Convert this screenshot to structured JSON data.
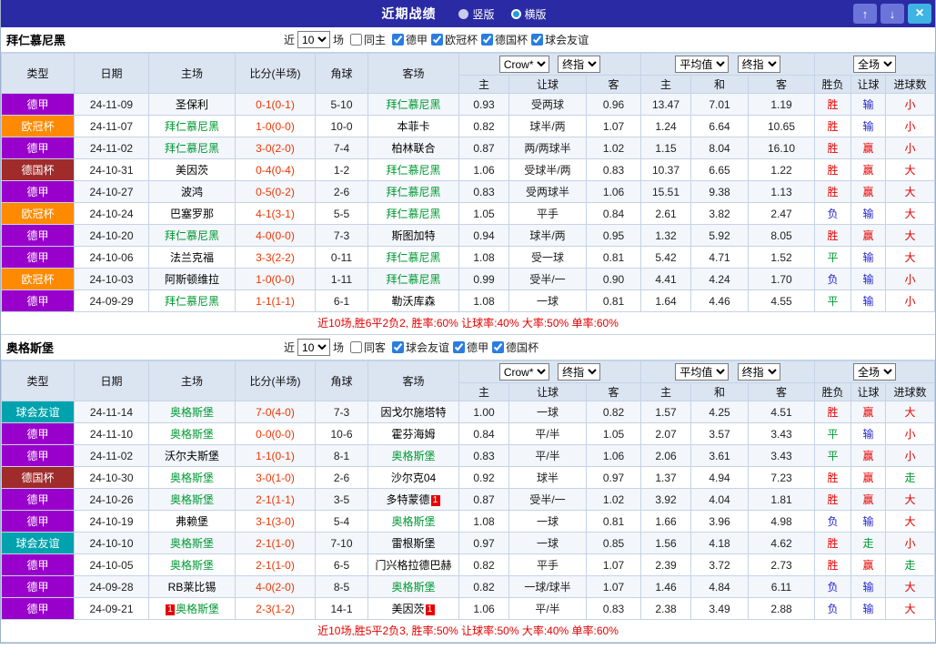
{
  "titlebar": {
    "title": "近期战绩",
    "options": [
      {
        "label": "竖版",
        "selected": false
      },
      {
        "label": "横版",
        "selected": true
      }
    ],
    "buttons": {
      "up": "↑",
      "down": "↓",
      "close": "×"
    }
  },
  "colors": {
    "titlebar_bg": "#2a2aa4",
    "header_bg": "#dbe5f2",
    "type": {
      "德甲": "#9900cc",
      "欧冠杯": "#ff8a00",
      "德国杯": "#a02b2b",
      "球会友谊": "#00a3ad"
    },
    "result": {
      "胜": "#e60000",
      "平": "#009933",
      "负": "#2525d0",
      "赢": "#e60000",
      "走": "#009933",
      "输": "#2525d0",
      "大": "#e60000",
      "小": "#e60000"
    },
    "self_team": "#009933",
    "score": "#f03500",
    "summary": "#e60000"
  },
  "table_header": {
    "type": "类型",
    "date": "日期",
    "home": "主场",
    "score": "比分(半场)",
    "corner": "角球",
    "away": "客场",
    "ah_home": "主",
    "ah_line": "让球",
    "ah_away": "客",
    "eu_home": "主",
    "eu_draw": "和",
    "eu_away": "客",
    "result": "胜负",
    "handicap": "让球",
    "goals": "进球数"
  },
  "sections": [
    {
      "team": "拜仁慕尼黑",
      "filter": {
        "near": "近",
        "count": "10",
        "games": "场",
        "same_label": "同主",
        "same_checked": false,
        "leagues": [
          {
            "label": "德甲",
            "checked": true
          },
          {
            "label": "欧冠杯",
            "checked": true
          },
          {
            "label": "德国杯",
            "checked": true
          },
          {
            "label": "球会友谊",
            "checked": true
          }
        ]
      },
      "dropdowns": {
        "source": "Crow*",
        "source_time": "终指",
        "avg": "平均值",
        "avg_time": "终指",
        "scope": "全场"
      },
      "rows": [
        {
          "type": "德甲",
          "date": "24-11-09",
          "home": "圣保利",
          "home_self": false,
          "score": "0-1(0-1)",
          "corner": "5-10",
          "away": "拜仁慕尼黑",
          "away_self": true,
          "ah": [
            "0.93",
            "受两球",
            "0.96"
          ],
          "eu": [
            "13.47",
            "7.01",
            "1.19"
          ],
          "res": [
            "胜",
            "输",
            "小"
          ]
        },
        {
          "type": "欧冠杯",
          "date": "24-11-07",
          "home": "拜仁慕尼黑",
          "home_self": true,
          "score": "1-0(0-0)",
          "corner": "10-0",
          "away": "本菲卡",
          "away_self": false,
          "ah": [
            "0.82",
            "球半/两",
            "1.07"
          ],
          "eu": [
            "1.24",
            "6.64",
            "10.65"
          ],
          "res": [
            "胜",
            "输",
            "小"
          ]
        },
        {
          "type": "德甲",
          "date": "24-11-02",
          "home": "拜仁慕尼黑",
          "home_self": true,
          "score": "3-0(2-0)",
          "corner": "7-4",
          "away": "柏林联合",
          "away_self": false,
          "ah": [
            "0.87",
            "两/两球半",
            "1.02"
          ],
          "eu": [
            "1.15",
            "8.04",
            "16.10"
          ],
          "res": [
            "胜",
            "赢",
            "小"
          ]
        },
        {
          "type": "德国杯",
          "date": "24-10-31",
          "home": "美因茨",
          "home_self": false,
          "score": "0-4(0-4)",
          "corner": "1-2",
          "away": "拜仁慕尼黑",
          "away_self": true,
          "ah": [
            "1.06",
            "受球半/两",
            "0.83"
          ],
          "eu": [
            "10.37",
            "6.65",
            "1.22"
          ],
          "res": [
            "胜",
            "赢",
            "大"
          ]
        },
        {
          "type": "德甲",
          "date": "24-10-27",
          "home": "波鸿",
          "home_self": false,
          "score": "0-5(0-2)",
          "corner": "2-6",
          "away": "拜仁慕尼黑",
          "away_self": true,
          "ah": [
            "0.83",
            "受两球半",
            "1.06"
          ],
          "eu": [
            "15.51",
            "9.38",
            "1.13"
          ],
          "res": [
            "胜",
            "赢",
            "大"
          ]
        },
        {
          "type": "欧冠杯",
          "date": "24-10-24",
          "home": "巴塞罗那",
          "home_self": false,
          "score": "4-1(3-1)",
          "corner": "5-5",
          "away": "拜仁慕尼黑",
          "away_self": true,
          "ah": [
            "1.05",
            "平手",
            "0.84"
          ],
          "eu": [
            "2.61",
            "3.82",
            "2.47"
          ],
          "res": [
            "负",
            "输",
            "大"
          ]
        },
        {
          "type": "德甲",
          "date": "24-10-20",
          "home": "拜仁慕尼黑",
          "home_self": true,
          "score": "4-0(0-0)",
          "corner": "7-3",
          "away": "斯图加特",
          "away_self": false,
          "ah": [
            "0.94",
            "球半/两",
            "0.95"
          ],
          "eu": [
            "1.32",
            "5.92",
            "8.05"
          ],
          "res": [
            "胜",
            "赢",
            "大"
          ]
        },
        {
          "type": "德甲",
          "date": "24-10-06",
          "home": "法兰克福",
          "home_self": false,
          "score": "3-3(2-2)",
          "corner": "0-11",
          "away": "拜仁慕尼黑",
          "away_self": true,
          "ah": [
            "1.08",
            "受一球",
            "0.81"
          ],
          "eu": [
            "5.42",
            "4.71",
            "1.52"
          ],
          "res": [
            "平",
            "输",
            "大"
          ]
        },
        {
          "type": "欧冠杯",
          "date": "24-10-03",
          "home": "阿斯顿维拉",
          "home_self": false,
          "score": "1-0(0-0)",
          "corner": "1-11",
          "away": "拜仁慕尼黑",
          "away_self": true,
          "ah": [
            "0.99",
            "受半/一",
            "0.90"
          ],
          "eu": [
            "4.41",
            "4.24",
            "1.70"
          ],
          "res": [
            "负",
            "输",
            "小"
          ]
        },
        {
          "type": "德甲",
          "date": "24-09-29",
          "home": "拜仁慕尼黑",
          "home_self": true,
          "score": "1-1(1-1)",
          "corner": "6-1",
          "away": "勒沃库森",
          "away_self": false,
          "ah": [
            "1.08",
            "一球",
            "0.81"
          ],
          "eu": [
            "1.64",
            "4.46",
            "4.55"
          ],
          "res": [
            "平",
            "输",
            "小"
          ]
        }
      ],
      "summary": "近10场,胜6平2负2, 胜率:60% 让球率:40% 大率:50% 单率:60%"
    },
    {
      "team": "奥格斯堡",
      "filter": {
        "near": "近",
        "count": "10",
        "games": "场",
        "same_label": "同客",
        "same_checked": false,
        "leagues": [
          {
            "label": "球会友谊",
            "checked": true
          },
          {
            "label": "德甲",
            "checked": true
          },
          {
            "label": "德国杯",
            "checked": true
          }
        ]
      },
      "dropdowns": {
        "source": "Crow*",
        "source_time": "终指",
        "avg": "平均值",
        "avg_time": "终指",
        "scope": "全场"
      },
      "rows": [
        {
          "type": "球会友谊",
          "date": "24-11-14",
          "home": "奥格斯堡",
          "home_self": true,
          "score": "7-0(4-0)",
          "corner": "7-3",
          "away": "因戈尔施塔特",
          "away_self": false,
          "ah": [
            "1.00",
            "一球",
            "0.82"
          ],
          "eu": [
            "1.57",
            "4.25",
            "4.51"
          ],
          "res": [
            "胜",
            "赢",
            "大"
          ]
        },
        {
          "type": "德甲",
          "date": "24-11-10",
          "home": "奥格斯堡",
          "home_self": true,
          "score": "0-0(0-0)",
          "corner": "10-6",
          "away": "霍芬海姆",
          "away_self": false,
          "ah": [
            "0.84",
            "平/半",
            "1.05"
          ],
          "eu": [
            "2.07",
            "3.57",
            "3.43"
          ],
          "res": [
            "平",
            "输",
            "小"
          ]
        },
        {
          "type": "德甲",
          "date": "24-11-02",
          "home": "沃尔夫斯堡",
          "home_self": false,
          "score": "1-1(0-1)",
          "corner": "8-1",
          "away": "奥格斯堡",
          "away_self": true,
          "ah": [
            "0.83",
            "平/半",
            "1.06"
          ],
          "eu": [
            "2.06",
            "3.61",
            "3.43"
          ],
          "res": [
            "平",
            "赢",
            "小"
          ]
        },
        {
          "type": "德国杯",
          "date": "24-10-30",
          "home": "奥格斯堡",
          "home_self": true,
          "score": "3-0(1-0)",
          "corner": "2-6",
          "away": "沙尔克04",
          "away_self": false,
          "ah": [
            "0.92",
            "球半",
            "0.97"
          ],
          "eu": [
            "1.37",
            "4.94",
            "7.23"
          ],
          "res": [
            "胜",
            "赢",
            "走"
          ]
        },
        {
          "type": "德甲",
          "date": "24-10-26",
          "home": "奥格斯堡",
          "home_self": true,
          "score": "2-1(1-1)",
          "corner": "3-5",
          "away": "多特蒙德",
          "away_self": false,
          "away_badge": "1",
          "ah": [
            "0.87",
            "受半/一",
            "1.02"
          ],
          "eu": [
            "3.92",
            "4.04",
            "1.81"
          ],
          "res": [
            "胜",
            "赢",
            "大"
          ]
        },
        {
          "type": "德甲",
          "date": "24-10-19",
          "home": "弗赖堡",
          "home_self": false,
          "score": "3-1(3-0)",
          "corner": "5-4",
          "away": "奥格斯堡",
          "away_self": true,
          "ah": [
            "1.08",
            "一球",
            "0.81"
          ],
          "eu": [
            "1.66",
            "3.96",
            "4.98"
          ],
          "res": [
            "负",
            "输",
            "大"
          ]
        },
        {
          "type": "球会友谊",
          "date": "24-10-10",
          "home": "奥格斯堡",
          "home_self": true,
          "score": "2-1(1-0)",
          "corner": "7-10",
          "away": "雷根斯堡",
          "away_self": false,
          "ah": [
            "0.97",
            "一球",
            "0.85"
          ],
          "eu": [
            "1.56",
            "4.18",
            "4.62"
          ],
          "res": [
            "胜",
            "走",
            "小"
          ]
        },
        {
          "type": "德甲",
          "date": "24-10-05",
          "home": "奥格斯堡",
          "home_self": true,
          "score": "2-1(1-0)",
          "corner": "6-5",
          "away": "门兴格拉德巴赫",
          "away_self": false,
          "ah": [
            "0.82",
            "平手",
            "1.07"
          ],
          "eu": [
            "2.39",
            "3.72",
            "2.73"
          ],
          "res": [
            "胜",
            "赢",
            "走"
          ]
        },
        {
          "type": "德甲",
          "date": "24-09-28",
          "home": "RB莱比锡",
          "home_self": false,
          "score": "4-0(2-0)",
          "corner": "8-5",
          "away": "奥格斯堡",
          "away_self": true,
          "ah": [
            "0.82",
            "一球/球半",
            "1.07"
          ],
          "eu": [
            "1.46",
            "4.84",
            "6.11"
          ],
          "res": [
            "负",
            "输",
            "大"
          ]
        },
        {
          "type": "德甲",
          "date": "24-09-21",
          "home": "奥格斯堡",
          "home_self": true,
          "home_badge": "1",
          "score": "2-3(1-2)",
          "corner": "14-1",
          "away": "美因茨",
          "away_self": false,
          "away_badge": "1",
          "ah": [
            "1.06",
            "平/半",
            "0.83"
          ],
          "eu": [
            "2.38",
            "3.49",
            "2.88"
          ],
          "res": [
            "负",
            "输",
            "大"
          ]
        }
      ],
      "summary": "近10场,胜5平2负3, 胜率:50% 让球率:50% 大率:40% 单率:60%"
    }
  ]
}
